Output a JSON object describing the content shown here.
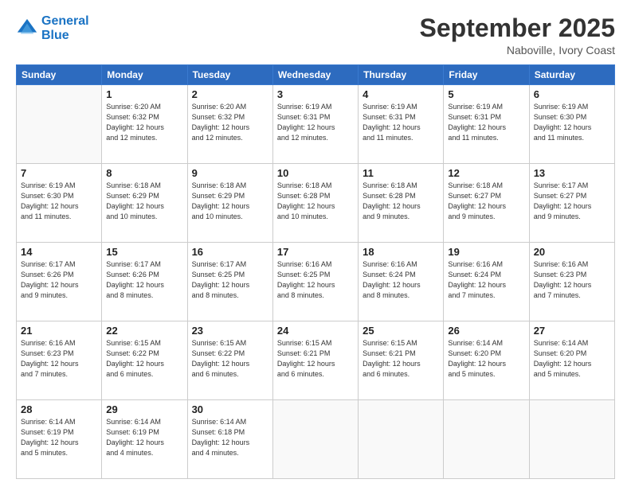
{
  "header": {
    "logo_line1": "General",
    "logo_line2": "Blue",
    "month_title": "September 2025",
    "location": "Naboville, Ivory Coast"
  },
  "weekdays": [
    "Sunday",
    "Monday",
    "Tuesday",
    "Wednesday",
    "Thursday",
    "Friday",
    "Saturday"
  ],
  "weeks": [
    [
      {
        "day": "",
        "info": ""
      },
      {
        "day": "1",
        "info": "Sunrise: 6:20 AM\nSunset: 6:32 PM\nDaylight: 12 hours\nand 12 minutes."
      },
      {
        "day": "2",
        "info": "Sunrise: 6:20 AM\nSunset: 6:32 PM\nDaylight: 12 hours\nand 12 minutes."
      },
      {
        "day": "3",
        "info": "Sunrise: 6:19 AM\nSunset: 6:31 PM\nDaylight: 12 hours\nand 12 minutes."
      },
      {
        "day": "4",
        "info": "Sunrise: 6:19 AM\nSunset: 6:31 PM\nDaylight: 12 hours\nand 11 minutes."
      },
      {
        "day": "5",
        "info": "Sunrise: 6:19 AM\nSunset: 6:31 PM\nDaylight: 12 hours\nand 11 minutes."
      },
      {
        "day": "6",
        "info": "Sunrise: 6:19 AM\nSunset: 6:30 PM\nDaylight: 12 hours\nand 11 minutes."
      }
    ],
    [
      {
        "day": "7",
        "info": "Sunrise: 6:19 AM\nSunset: 6:30 PM\nDaylight: 12 hours\nand 11 minutes."
      },
      {
        "day": "8",
        "info": "Sunrise: 6:18 AM\nSunset: 6:29 PM\nDaylight: 12 hours\nand 10 minutes."
      },
      {
        "day": "9",
        "info": "Sunrise: 6:18 AM\nSunset: 6:29 PM\nDaylight: 12 hours\nand 10 minutes."
      },
      {
        "day": "10",
        "info": "Sunrise: 6:18 AM\nSunset: 6:28 PM\nDaylight: 12 hours\nand 10 minutes."
      },
      {
        "day": "11",
        "info": "Sunrise: 6:18 AM\nSunset: 6:28 PM\nDaylight: 12 hours\nand 9 minutes."
      },
      {
        "day": "12",
        "info": "Sunrise: 6:18 AM\nSunset: 6:27 PM\nDaylight: 12 hours\nand 9 minutes."
      },
      {
        "day": "13",
        "info": "Sunrise: 6:17 AM\nSunset: 6:27 PM\nDaylight: 12 hours\nand 9 minutes."
      }
    ],
    [
      {
        "day": "14",
        "info": "Sunrise: 6:17 AM\nSunset: 6:26 PM\nDaylight: 12 hours\nand 9 minutes."
      },
      {
        "day": "15",
        "info": "Sunrise: 6:17 AM\nSunset: 6:26 PM\nDaylight: 12 hours\nand 8 minutes."
      },
      {
        "day": "16",
        "info": "Sunrise: 6:17 AM\nSunset: 6:25 PM\nDaylight: 12 hours\nand 8 minutes."
      },
      {
        "day": "17",
        "info": "Sunrise: 6:16 AM\nSunset: 6:25 PM\nDaylight: 12 hours\nand 8 minutes."
      },
      {
        "day": "18",
        "info": "Sunrise: 6:16 AM\nSunset: 6:24 PM\nDaylight: 12 hours\nand 8 minutes."
      },
      {
        "day": "19",
        "info": "Sunrise: 6:16 AM\nSunset: 6:24 PM\nDaylight: 12 hours\nand 7 minutes."
      },
      {
        "day": "20",
        "info": "Sunrise: 6:16 AM\nSunset: 6:23 PM\nDaylight: 12 hours\nand 7 minutes."
      }
    ],
    [
      {
        "day": "21",
        "info": "Sunrise: 6:16 AM\nSunset: 6:23 PM\nDaylight: 12 hours\nand 7 minutes."
      },
      {
        "day": "22",
        "info": "Sunrise: 6:15 AM\nSunset: 6:22 PM\nDaylight: 12 hours\nand 6 minutes."
      },
      {
        "day": "23",
        "info": "Sunrise: 6:15 AM\nSunset: 6:22 PM\nDaylight: 12 hours\nand 6 minutes."
      },
      {
        "day": "24",
        "info": "Sunrise: 6:15 AM\nSunset: 6:21 PM\nDaylight: 12 hours\nand 6 minutes."
      },
      {
        "day": "25",
        "info": "Sunrise: 6:15 AM\nSunset: 6:21 PM\nDaylight: 12 hours\nand 6 minutes."
      },
      {
        "day": "26",
        "info": "Sunrise: 6:14 AM\nSunset: 6:20 PM\nDaylight: 12 hours\nand 5 minutes."
      },
      {
        "day": "27",
        "info": "Sunrise: 6:14 AM\nSunset: 6:20 PM\nDaylight: 12 hours\nand 5 minutes."
      }
    ],
    [
      {
        "day": "28",
        "info": "Sunrise: 6:14 AM\nSunset: 6:19 PM\nDaylight: 12 hours\nand 5 minutes."
      },
      {
        "day": "29",
        "info": "Sunrise: 6:14 AM\nSunset: 6:19 PM\nDaylight: 12 hours\nand 4 minutes."
      },
      {
        "day": "30",
        "info": "Sunrise: 6:14 AM\nSunset: 6:18 PM\nDaylight: 12 hours\nand 4 minutes."
      },
      {
        "day": "",
        "info": ""
      },
      {
        "day": "",
        "info": ""
      },
      {
        "day": "",
        "info": ""
      },
      {
        "day": "",
        "info": ""
      }
    ]
  ]
}
